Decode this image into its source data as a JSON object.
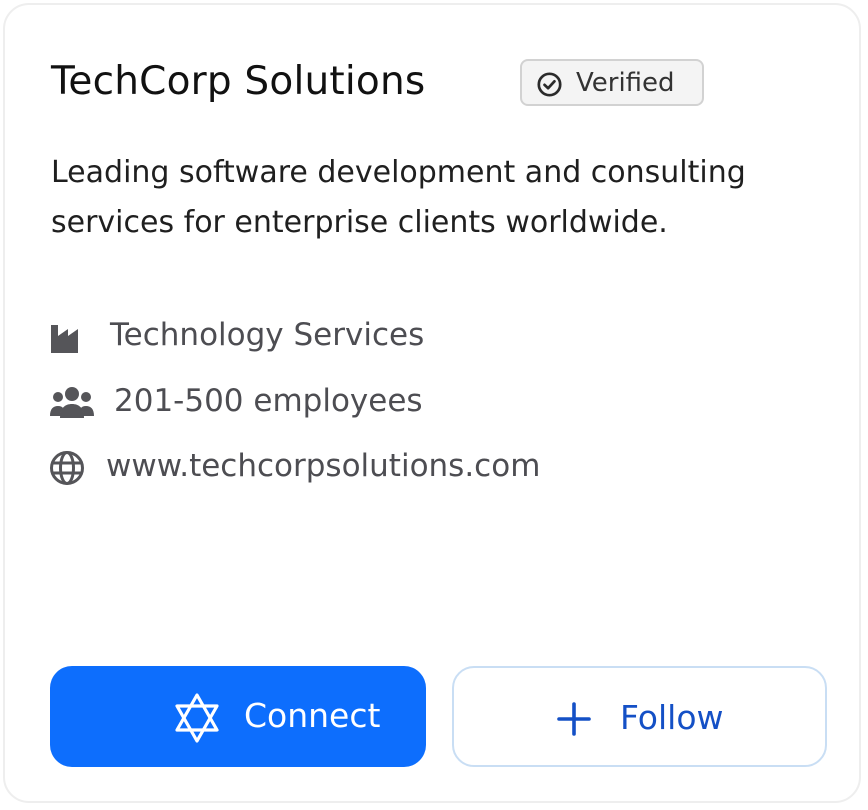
{
  "company": {
    "name": "TechCorp Solutions",
    "verified_label": "Verified",
    "description": "Leading software development and consulting services for enterprise clients worldwide.",
    "industry": "Technology Services",
    "size": "201-500 employees",
    "website": "www.techcorpsolutions.com"
  },
  "actions": {
    "connect_label": "Connect",
    "follow_label": "Follow"
  },
  "icons": {
    "verified": "check-circle-icon",
    "industry": "factory-icon",
    "size": "users-icon",
    "website": "globe-icon",
    "connect": "star-of-david-icon",
    "follow": "plus-icon"
  },
  "colors": {
    "primary": "#0d6efd",
    "follow_text": "#1450c6",
    "follow_border": "#c9def4",
    "meta_text": "#4d4d52"
  }
}
